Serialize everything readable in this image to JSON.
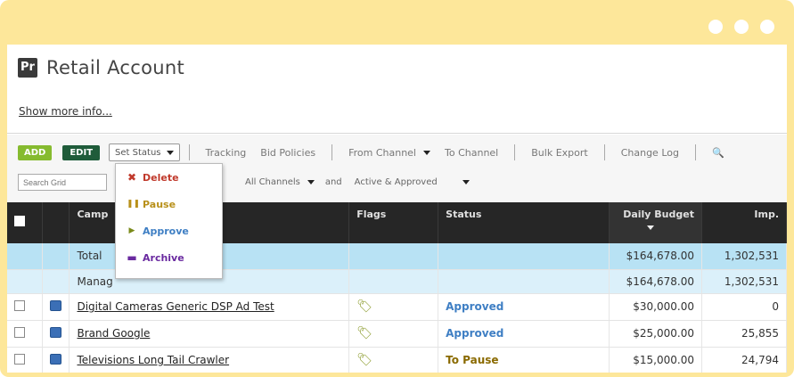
{
  "window": {
    "controls": [
      "dot-1",
      "dot-2",
      "dot-3"
    ]
  },
  "header": {
    "logo_text": "Pr",
    "title": "Retail Account",
    "show_more": "Show more info..."
  },
  "toolbar": {
    "add_label": "ADD",
    "edit_label": "EDIT",
    "set_status_label": "Set Status",
    "links": [
      "Tracking",
      "Bid Policies"
    ],
    "from_channel": "From Channel",
    "to_channel": "To Channel",
    "bulk_export": "Bulk Export",
    "change_log": "Change Log",
    "search_placeholder": "Search Grid",
    "channel_filter": "All Channels",
    "and_label": "and",
    "status_filter": "Active & Approved"
  },
  "status_menu": {
    "items": [
      {
        "label": "Delete",
        "icon": "delete-icon",
        "color": "#c0392b",
        "glyph": "✖"
      },
      {
        "label": "Pause",
        "icon": "pause-icon",
        "color": "#b8901a",
        "glyph": "❚❚"
      },
      {
        "label": "Approve",
        "icon": "approve-icon",
        "color": "#3f7fc4",
        "glyph": "▶"
      },
      {
        "label": "Archive",
        "icon": "archive-icon",
        "color": "#6a2aa0",
        "glyph": "▬"
      }
    ]
  },
  "table": {
    "columns": [
      "Camp",
      "Flags",
      "Status",
      "Daily Budget",
      "Imp."
    ],
    "totals": {
      "label": "Total",
      "budget": "$164,678.00",
      "impressions": "1,302,531"
    },
    "managed": {
      "label": "Manag",
      "budget": "$164,678.00",
      "impressions": "1,302,531"
    },
    "rows": [
      {
        "name": "Digital Cameras Generic DSP Ad Test",
        "status": "Approved",
        "budget": "$30,000.00",
        "impressions": "0"
      },
      {
        "name": "Brand Google",
        "status": "Approved",
        "budget": "$25,000.00",
        "impressions": "25,855"
      },
      {
        "name": "Televisions Long Tail Crawler",
        "status": "To Pause",
        "budget": "$15,000.00",
        "impressions": "24,794"
      }
    ]
  },
  "colors": {
    "frame": "#fde79a",
    "add_button": "#86bb2f",
    "edit_button": "#1f5c3a",
    "header_bar": "#262626",
    "totals_row": "#b8e2f4"
  }
}
